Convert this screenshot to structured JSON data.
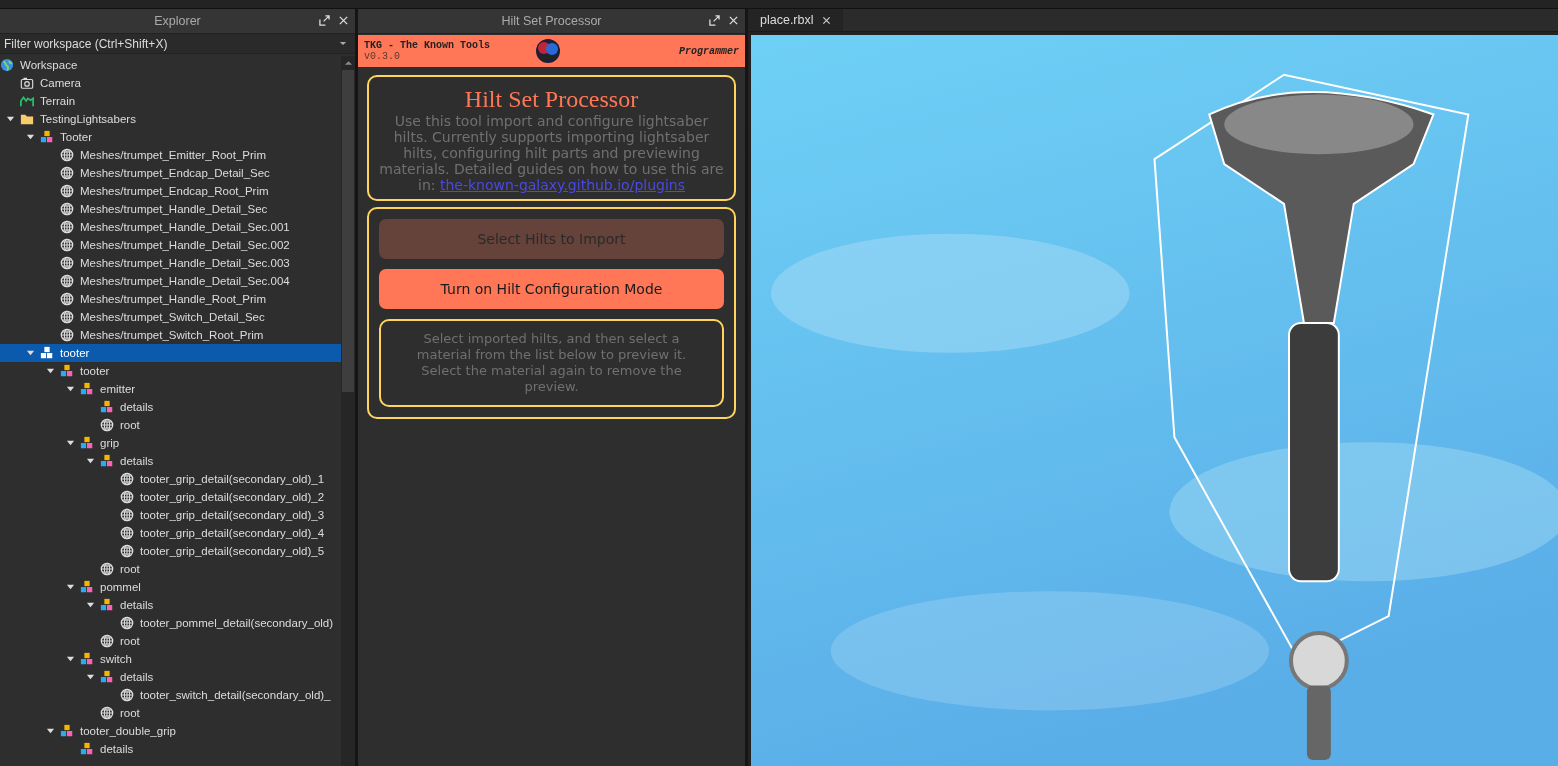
{
  "explorer": {
    "title": "Explorer",
    "filter": {
      "placeholder": "Filter workspace (Ctrl+Shift+X)"
    },
    "tree": [
      {
        "label": "Workspace",
        "kind": "workspace",
        "selected": false,
        "children": [
          {
            "label": "Camera",
            "kind": "camera",
            "selected": false
          },
          {
            "label": "Terrain",
            "kind": "terrain",
            "selected": false
          },
          {
            "label": "TestingLightsabers",
            "kind": "folder",
            "selected": false,
            "expanded": true,
            "children": [
              {
                "label": "Tooter",
                "kind": "model",
                "selected": false,
                "expanded": true,
                "children": [
                  {
                    "label": "Meshes/trumpet_Emitter_Root_Prim",
                    "kind": "mesh",
                    "selected": false
                  },
                  {
                    "label": "Meshes/trumpet_Endcap_Detail_Sec",
                    "kind": "mesh",
                    "selected": false
                  },
                  {
                    "label": "Meshes/trumpet_Endcap_Root_Prim",
                    "kind": "mesh",
                    "selected": false
                  },
                  {
                    "label": "Meshes/trumpet_Handle_Detail_Sec",
                    "kind": "mesh",
                    "selected": false
                  },
                  {
                    "label": "Meshes/trumpet_Handle_Detail_Sec.001",
                    "kind": "mesh",
                    "selected": false
                  },
                  {
                    "label": "Meshes/trumpet_Handle_Detail_Sec.002",
                    "kind": "mesh",
                    "selected": false
                  },
                  {
                    "label": "Meshes/trumpet_Handle_Detail_Sec.003",
                    "kind": "mesh",
                    "selected": false
                  },
                  {
                    "label": "Meshes/trumpet_Handle_Detail_Sec.004",
                    "kind": "mesh",
                    "selected": false
                  },
                  {
                    "label": "Meshes/trumpet_Handle_Root_Prim",
                    "kind": "mesh",
                    "selected": false
                  },
                  {
                    "label": "Meshes/trumpet_Switch_Detail_Sec",
                    "kind": "mesh",
                    "selected": false
                  },
                  {
                    "label": "Meshes/trumpet_Switch_Root_Prim",
                    "kind": "mesh",
                    "selected": false
                  }
                ]
              },
              {
                "label": "tooter",
                "kind": "model",
                "selected": true,
                "expanded": true,
                "children": [
                  {
                    "label": "tooter",
                    "kind": "model",
                    "selected": false,
                    "expanded": true,
                    "children": [
                      {
                        "label": "emitter",
                        "kind": "model",
                        "selected": false,
                        "expanded": true,
                        "children": [
                          {
                            "label": "details",
                            "kind": "model",
                            "selected": false
                          },
                          {
                            "label": "root",
                            "kind": "mesh",
                            "selected": false
                          }
                        ]
                      },
                      {
                        "label": "grip",
                        "kind": "model",
                        "selected": false,
                        "expanded": true,
                        "children": [
                          {
                            "label": "details",
                            "kind": "model",
                            "selected": false,
                            "expanded": true,
                            "children": [
                              {
                                "label": "tooter_grip_detail(secondary_old)_1",
                                "kind": "mesh",
                                "selected": false
                              },
                              {
                                "label": "tooter_grip_detail(secondary_old)_2",
                                "kind": "mesh",
                                "selected": false
                              },
                              {
                                "label": "tooter_grip_detail(secondary_old)_3",
                                "kind": "mesh",
                                "selected": false
                              },
                              {
                                "label": "tooter_grip_detail(secondary_old)_4",
                                "kind": "mesh",
                                "selected": false
                              },
                              {
                                "label": "tooter_grip_detail(secondary_old)_5",
                                "kind": "mesh",
                                "selected": false
                              }
                            ]
                          },
                          {
                            "label": "root",
                            "kind": "mesh",
                            "selected": false
                          }
                        ]
                      },
                      {
                        "label": "pommel",
                        "kind": "model",
                        "selected": false,
                        "expanded": true,
                        "children": [
                          {
                            "label": "details",
                            "kind": "model",
                            "selected": false,
                            "expanded": true,
                            "children": [
                              {
                                "label": "tooter_pommel_detail(secondary_old)",
                                "kind": "mesh",
                                "selected": false
                              }
                            ]
                          },
                          {
                            "label": "root",
                            "kind": "mesh",
                            "selected": false
                          }
                        ]
                      },
                      {
                        "label": "switch",
                        "kind": "model",
                        "selected": false,
                        "expanded": true,
                        "children": [
                          {
                            "label": "details",
                            "kind": "model",
                            "selected": false,
                            "expanded": true,
                            "children": [
                              {
                                "label": "tooter_switch_detail(secondary_old)_",
                                "kind": "mesh",
                                "selected": false
                              }
                            ]
                          },
                          {
                            "label": "root",
                            "kind": "mesh",
                            "selected": false
                          }
                        ]
                      }
                    ]
                  },
                  {
                    "label": "tooter_double_grip",
                    "kind": "model",
                    "selected": false,
                    "expanded": true,
                    "children": [
                      {
                        "label": "details",
                        "kind": "model",
                        "selected": false
                      }
                    ]
                  }
                ]
              }
            ]
          }
        ]
      }
    ]
  },
  "plugin": {
    "title": "Hilt Set Processor",
    "banner": {
      "name": "TKG - The Known Tools",
      "version": "v0.3.0",
      "role": "Programmer"
    },
    "intro": {
      "heading": "Hilt Set Processor",
      "text": "Use this tool import and configure lightsaber hilts. Currently supports importing lightsaber hilts, configuring hilt parts and previewing materials. Detailed guides on how to use this are in: ",
      "link": "the-known-galaxy.github.io/plugins"
    },
    "buttons": [
      {
        "label": "Select Hilts to Import",
        "disabled": true
      },
      {
        "label": "Turn on Hilt Configuration Mode",
        "disabled": false
      }
    ],
    "hint": "Select imported hilts, and then select a material from the list below to preview it. Select the material again to remove the preview."
  },
  "viewport": {
    "tabs": [
      {
        "label": "place.rbxl",
        "selected": true
      }
    ]
  }
}
